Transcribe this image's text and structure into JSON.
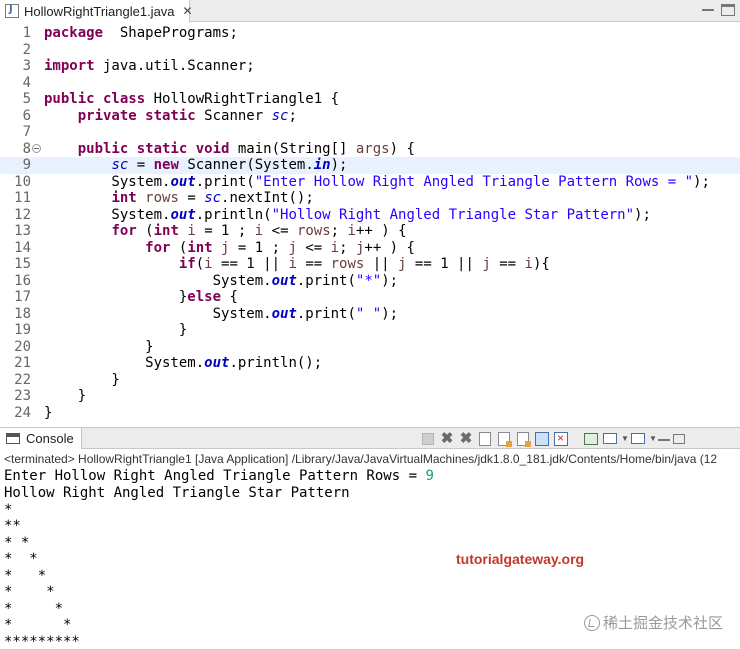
{
  "editor": {
    "tab_title": "HollowRightTriangle1.java",
    "tab_close": "✕",
    "lines": [
      {
        "n": "1",
        "tokens": [
          [
            "kw",
            "package"
          ],
          [
            "",
            "  ShapePrograms;"
          ]
        ]
      },
      {
        "n": "2",
        "tokens": []
      },
      {
        "n": "3",
        "tokens": [
          [
            "kw",
            "import"
          ],
          [
            "",
            " java.util.Scanner;"
          ]
        ]
      },
      {
        "n": "4",
        "tokens": []
      },
      {
        "n": "5",
        "tokens": [
          [
            "kw",
            "public class"
          ],
          [
            "",
            " HollowRightTriangle1 {"
          ]
        ]
      },
      {
        "n": "6",
        "tokens": [
          [
            "",
            "    "
          ],
          [
            "kw",
            "private static"
          ],
          [
            "",
            " Scanner "
          ],
          [
            "sfld",
            "sc"
          ],
          [
            "",
            ";"
          ]
        ]
      },
      {
        "n": "7",
        "tokens": []
      },
      {
        "n": "8",
        "tokens": [
          [
            "",
            "    "
          ],
          [
            "kw",
            "public static void"
          ],
          [
            "",
            " main(String[] "
          ],
          [
            "var",
            "args"
          ],
          [
            "",
            ") {"
          ]
        ]
      },
      {
        "n": "9",
        "tokens": [
          [
            "",
            "        "
          ],
          [
            "sfld",
            "sc"
          ],
          [
            "",
            " = "
          ],
          [
            "kw",
            "new"
          ],
          [
            "",
            " Scanner(System."
          ],
          [
            "sfldb",
            "in"
          ],
          [
            "",
            ");"
          ]
        ]
      },
      {
        "n": "10",
        "tokens": [
          [
            "",
            "        System."
          ],
          [
            "sfldb",
            "out"
          ],
          [
            "",
            ".print("
          ],
          [
            "str",
            "\"Enter Hollow Right Angled Triangle Pattern Rows = \""
          ],
          [
            "",
            ");"
          ]
        ]
      },
      {
        "n": "11",
        "tokens": [
          [
            "",
            "        "
          ],
          [
            "kw",
            "int"
          ],
          [
            "",
            " "
          ],
          [
            "var",
            "rows"
          ],
          [
            "",
            " = "
          ],
          [
            "sfld",
            "sc"
          ],
          [
            "",
            ".nextInt();"
          ]
        ]
      },
      {
        "n": "12",
        "tokens": [
          [
            "",
            "        System."
          ],
          [
            "sfldb",
            "out"
          ],
          [
            "",
            ".println("
          ],
          [
            "str",
            "\"Hollow Right Angled Triangle Star Pattern\""
          ],
          [
            "",
            ");"
          ]
        ]
      },
      {
        "n": "13",
        "tokens": [
          [
            "",
            "        "
          ],
          [
            "kw",
            "for"
          ],
          [
            "",
            " ("
          ],
          [
            "kw",
            "int"
          ],
          [
            "",
            " "
          ],
          [
            "var",
            "i"
          ],
          [
            "",
            " = 1 ; "
          ],
          [
            "var",
            "i"
          ],
          [
            "",
            " <= "
          ],
          [
            "var",
            "rows"
          ],
          [
            "",
            "; "
          ],
          [
            "var",
            "i"
          ],
          [
            "",
            "++ ) {"
          ]
        ]
      },
      {
        "n": "14",
        "tokens": [
          [
            "",
            "            "
          ],
          [
            "kw",
            "for"
          ],
          [
            "",
            " ("
          ],
          [
            "kw",
            "int"
          ],
          [
            "",
            " "
          ],
          [
            "var",
            "j"
          ],
          [
            "",
            " = 1 ; "
          ],
          [
            "var",
            "j"
          ],
          [
            "",
            " <= "
          ],
          [
            "var",
            "i"
          ],
          [
            "",
            "; "
          ],
          [
            "var",
            "j"
          ],
          [
            "",
            "++ ) {"
          ]
        ]
      },
      {
        "n": "15",
        "tokens": [
          [
            "",
            "                "
          ],
          [
            "kw",
            "if"
          ],
          [
            "",
            "("
          ],
          [
            "var",
            "i"
          ],
          [
            "",
            " == 1 || "
          ],
          [
            "var",
            "i"
          ],
          [
            "",
            " == "
          ],
          [
            "var",
            "rows"
          ],
          [
            "",
            " || "
          ],
          [
            "var",
            "j"
          ],
          [
            "",
            " == 1 || "
          ],
          [
            "var",
            "j"
          ],
          [
            "",
            " == "
          ],
          [
            "var",
            "i"
          ],
          [
            "",
            "){"
          ]
        ]
      },
      {
        "n": "16",
        "tokens": [
          [
            "",
            "                    System."
          ],
          [
            "sfldb",
            "out"
          ],
          [
            "",
            ".print("
          ],
          [
            "str",
            "\"*\""
          ],
          [
            "",
            ");"
          ]
        ]
      },
      {
        "n": "17",
        "tokens": [
          [
            "",
            "                }"
          ],
          [
            "kw",
            "else"
          ],
          [
            "",
            " {"
          ]
        ]
      },
      {
        "n": "18",
        "tokens": [
          [
            "",
            "                    System."
          ],
          [
            "sfldb",
            "out"
          ],
          [
            "",
            ".print("
          ],
          [
            "str",
            "\" \""
          ],
          [
            "",
            ");"
          ]
        ]
      },
      {
        "n": "19",
        "tokens": [
          [
            "",
            "                }"
          ]
        ]
      },
      {
        "n": "20",
        "tokens": [
          [
            "",
            "            }"
          ]
        ]
      },
      {
        "n": "21",
        "tokens": [
          [
            "",
            "            System."
          ],
          [
            "sfldb",
            "out"
          ],
          [
            "",
            ".println();"
          ]
        ]
      },
      {
        "n": "22",
        "tokens": [
          [
            "",
            "        }"
          ]
        ]
      },
      {
        "n": "23",
        "tokens": [
          [
            "",
            "    }"
          ]
        ]
      },
      {
        "n": "24",
        "tokens": [
          [
            "",
            "}"
          ]
        ]
      }
    ]
  },
  "console": {
    "tab_label": "Console",
    "status": "<terminated> HollowRightTriangle1 [Java Application] /Library/Java/JavaVirtualMachines/jdk1.8.0_181.jdk/Contents/Home/bin/java  (12",
    "prompt": "Enter Hollow Right Angled Triangle Pattern Rows = ",
    "input_value": "9",
    "output_lines": [
      "Hollow Right Angled Triangle Star Pattern",
      "*",
      "**",
      "* *",
      "*  *",
      "*   *",
      "*    *",
      "*     *",
      "*      *",
      "*********"
    ]
  },
  "watermarks": {
    "site": "tutorialgateway.org",
    "juejin": "稀土掘金技术社区"
  }
}
